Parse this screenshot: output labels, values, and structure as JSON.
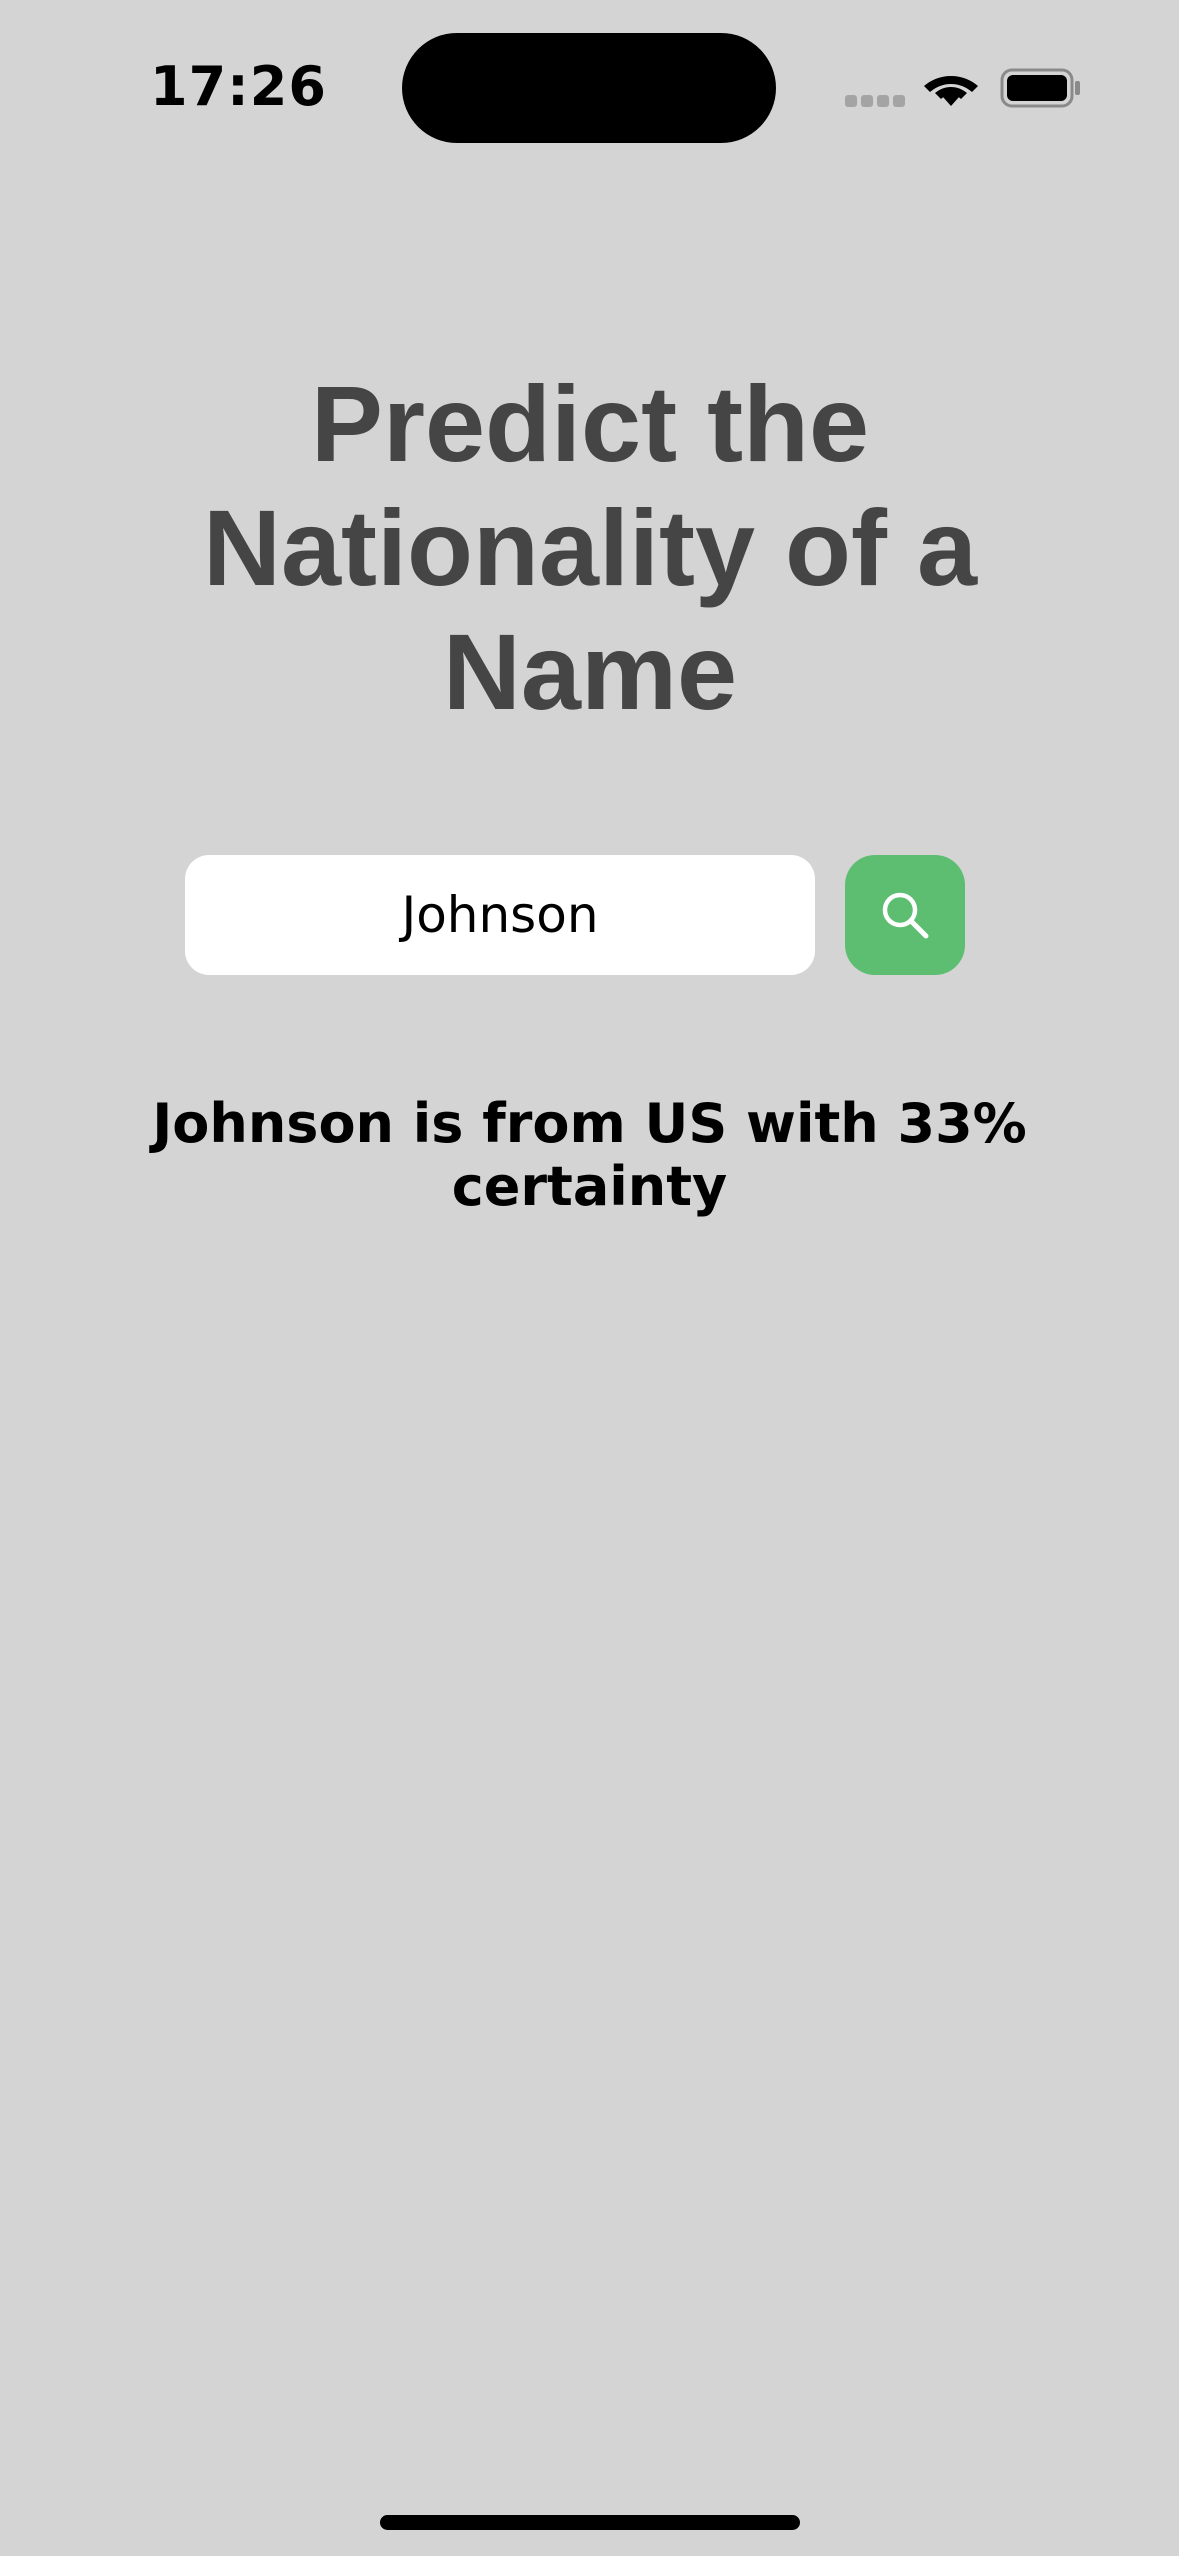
{
  "status_bar": {
    "time": "17:26"
  },
  "title": "Predict the Nationality of a Name",
  "search": {
    "value": "Johnson",
    "placeholder": ""
  },
  "search_button": {
    "icon": "search-icon"
  },
  "result": "Johnson is from US with 33% certainty",
  "colors": {
    "background": "#d4d4d4",
    "title": "#454545",
    "accent": "#5dbe72"
  }
}
